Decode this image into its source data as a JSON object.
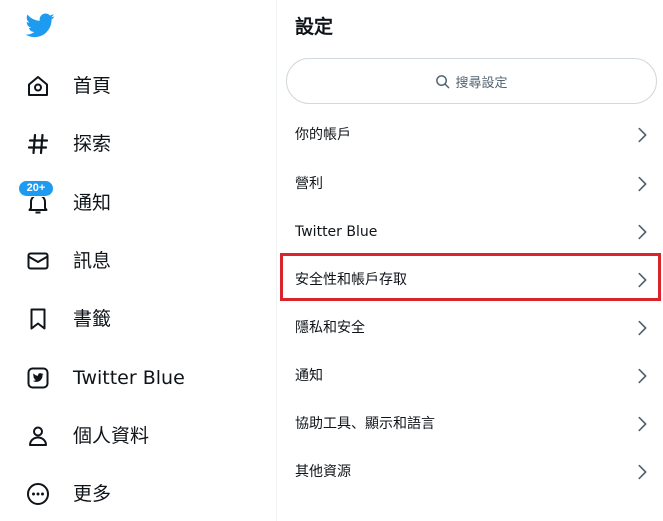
{
  "nav": {
    "logo_icon": "twitter-bird-icon",
    "items": [
      {
        "label": "首頁",
        "icon": "home-icon"
      },
      {
        "label": "探索",
        "icon": "hashtag-icon"
      },
      {
        "label": "通知",
        "icon": "bell-icon",
        "badge": "20+"
      },
      {
        "label": "訊息",
        "icon": "envelope-icon"
      },
      {
        "label": "書籤",
        "icon": "bookmark-icon"
      },
      {
        "label": "Twitter Blue",
        "icon": "twitter-blue-icon"
      },
      {
        "label": "個人資料",
        "icon": "person-icon"
      },
      {
        "label": "更多",
        "icon": "more-circle-icon"
      }
    ]
  },
  "settings": {
    "title": "設定",
    "search_placeholder": "搜尋設定",
    "items": [
      {
        "label": "你的帳戶"
      },
      {
        "label": "營利"
      },
      {
        "label": "Twitter Blue"
      },
      {
        "label": "安全性和帳戶存取",
        "highlighted": true
      },
      {
        "label": "隱私和安全"
      },
      {
        "label": "通知"
      },
      {
        "label": "協助工具、顯示和語言"
      },
      {
        "label": "其他資源"
      }
    ]
  },
  "colors": {
    "brand": "#1d9bf0",
    "text": "#0f1419",
    "secondary_text": "#536471",
    "highlight_border": "#d9232d"
  }
}
